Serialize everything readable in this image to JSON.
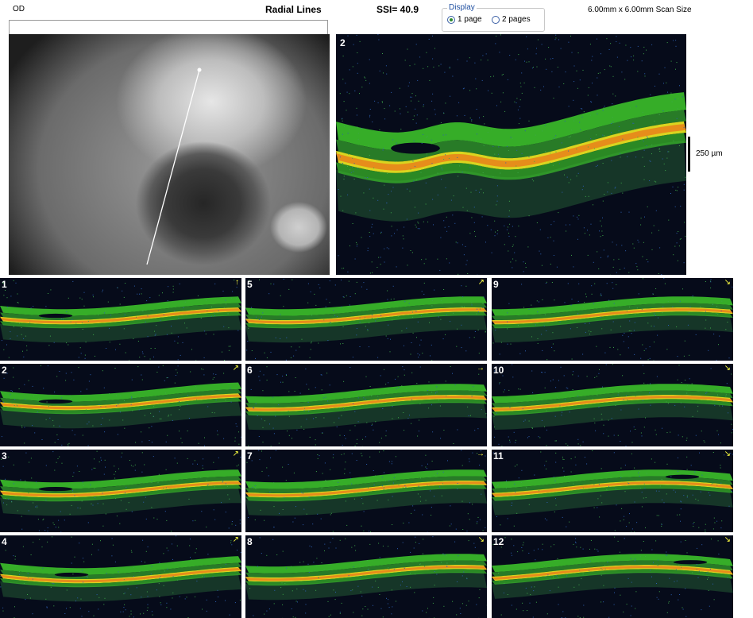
{
  "header": {
    "eye": "OD",
    "protocol": "Radial Lines",
    "ssi": "SSI= 40.9",
    "scan_size": "6.00mm x 6.00mm Scan Size"
  },
  "display": {
    "legend": "Display",
    "options": [
      "1 page",
      "2 pages"
    ],
    "selected": "1 page"
  },
  "main_scan": {
    "number": "2",
    "scale_label": "250 µm"
  },
  "thumbnails": [
    {
      "number": "1",
      "arrow": "↑"
    },
    {
      "number": "2",
      "arrow": "↗"
    },
    {
      "number": "3",
      "arrow": "↗"
    },
    {
      "number": "4",
      "arrow": "↗"
    },
    {
      "number": "5",
      "arrow": "↗"
    },
    {
      "number": "6",
      "arrow": "→"
    },
    {
      "number": "7",
      "arrow": "→"
    },
    {
      "number": "8",
      "arrow": "↘"
    },
    {
      "number": "9",
      "arrow": "↘"
    },
    {
      "number": "10",
      "arrow": "↘"
    },
    {
      "number": "11",
      "arrow": "↘"
    },
    {
      "number": "12",
      "arrow": "↘"
    }
  ],
  "colors": {
    "background_scan": "#060b1a",
    "retina_green": "#3cbf2a",
    "retina_yellow": "#e6e020",
    "retina_orange": "#e87a1a",
    "arrow_yellow": "#ffff40",
    "legend_blue": "#1f4fa0"
  }
}
